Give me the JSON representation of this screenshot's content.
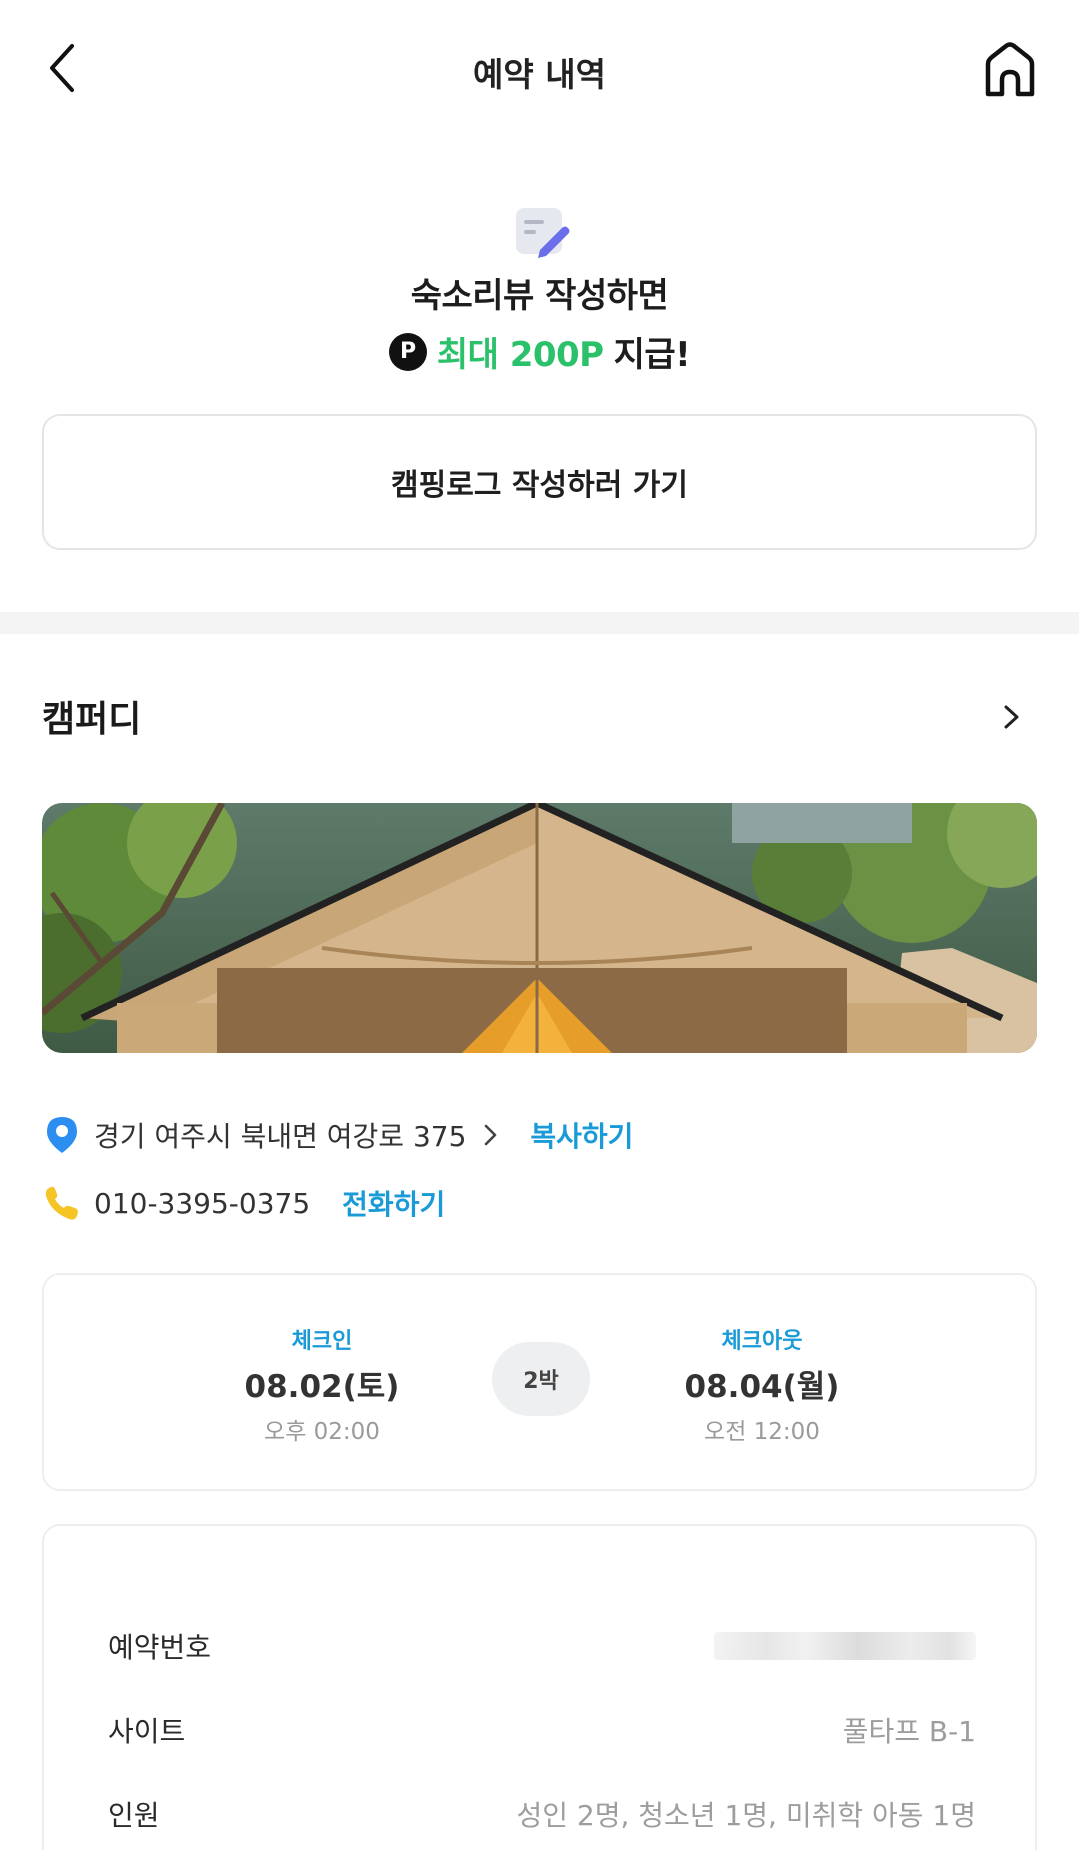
{
  "header": {
    "title": "예약 내역",
    "back_icon": "chevron-left-icon",
    "home_icon": "home-icon"
  },
  "review_promo": {
    "icon": "memo-edit-icon",
    "line1": "숙소리뷰 작성하면",
    "point_badge": "P",
    "point_text": "최대 200P",
    "line2_suffix": "지급!",
    "point_color": "#2bc16a"
  },
  "write_log_button": {
    "label": "캠핑로그 작성하러 가기"
  },
  "campsite": {
    "name": "캠퍼디",
    "address": "경기 여주시 북내면 여강로 375",
    "copy_label": "복사하기",
    "phone": "010-3395-0375",
    "call_label": "전화하기",
    "link_color": "#1a9bd7"
  },
  "stay": {
    "checkin_label": "체크인",
    "checkin_date": "08.02(토)",
    "checkin_time": "오후 02:00",
    "nights": "2박",
    "checkout_label": "체크아웃",
    "checkout_date": "08.04(월)",
    "checkout_time": "오전 12:00"
  },
  "details": [
    {
      "label": "예약번호",
      "value": ""
    },
    {
      "label": "사이트",
      "value": "풀타프 B-1"
    },
    {
      "label": "인원",
      "value": "성인 2명, 청소년 1명, 미취학 아동 1명"
    }
  ]
}
